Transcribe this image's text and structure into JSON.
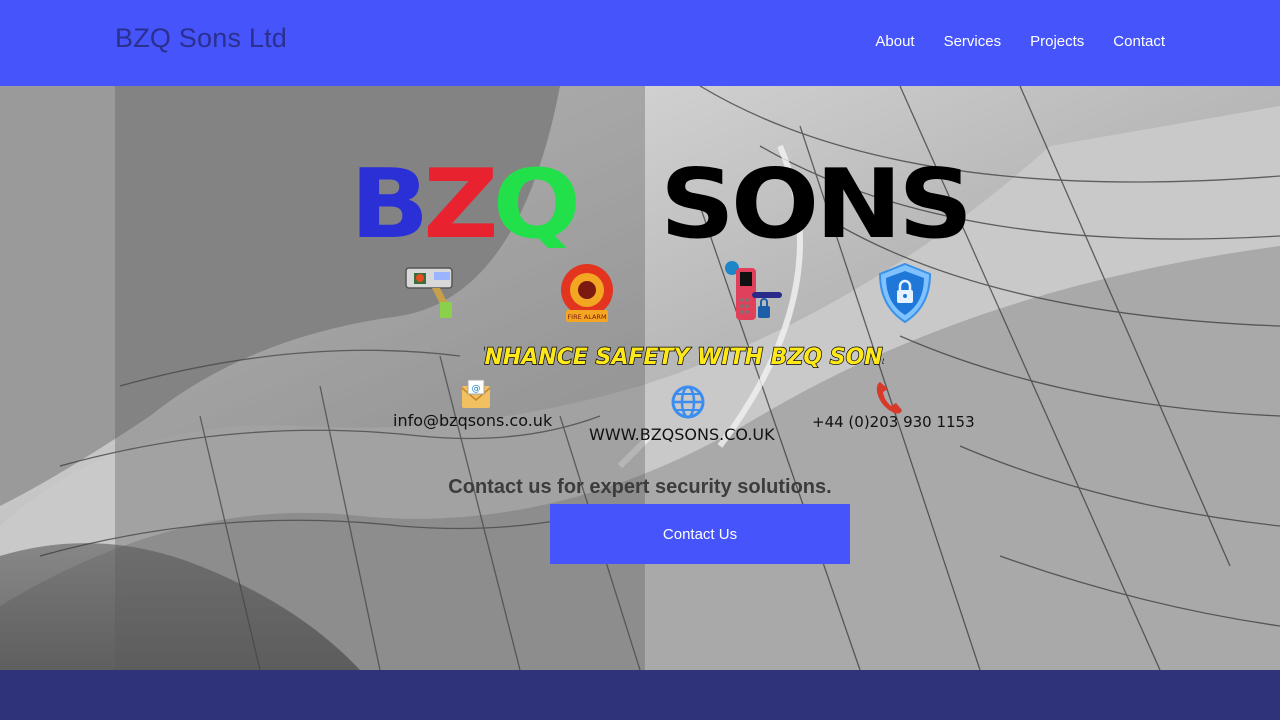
{
  "header": {
    "site_title": "BZQ Sons Ltd",
    "nav": [
      "About",
      "Services",
      "Projects",
      "Contact"
    ]
  },
  "hero": {
    "logo": {
      "part1": "BZQ",
      "part2": "SONS"
    },
    "tagline": "ENHANCE SAFETY WITH BZQ SONS",
    "icons": [
      "cctv-camera-icon",
      "fire-alarm-icon",
      "smart-lock-icon",
      "security-shield-icon"
    ],
    "icon_labels": {
      "fire_alarm": "FIRE ALARM"
    },
    "contacts": {
      "email": "info@bzqsons.co.uk",
      "website": "WWW.BZQSONS.CO.UK",
      "phone": "+44 (0)203 930 1153"
    },
    "cta_heading": "Contact us for expert security solutions.",
    "cta_button": "Contact Us"
  },
  "colors": {
    "header_bg": "#4654fb",
    "footer_bg": "#2f347a",
    "logo_b": "#2b2fd6",
    "logo_z": "#e8232f",
    "logo_q": "#22e04a",
    "tagline": "#ffe81a"
  }
}
